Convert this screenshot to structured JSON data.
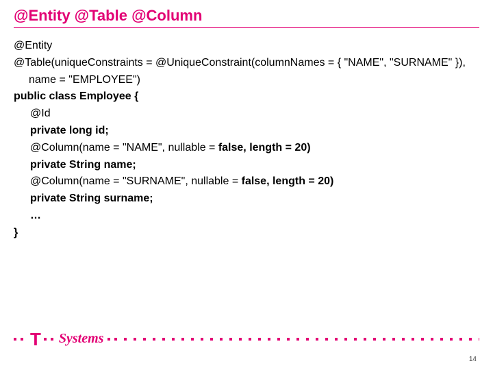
{
  "title": "@Entity @Table @Column",
  "code": {
    "l1": "@Entity",
    "l2": "@Table(uniqueConstraints = @UniqueConstraint(columnNames = { \"NAME\", \"SURNAME\" }), name = \"EMPLOYEE\")",
    "l3a": "public class Employee",
    "l3b": " {",
    "l4": "@Id",
    "l5": "private long id;",
    "l6a": "@Column(name = \"NAME\", nullable = ",
    "l6b": "false, length = 20)",
    "l7": "private String name;",
    "l8a": "@Column(name = \"SURNAME\", nullable = ",
    "l8b": "false, length = 20)",
    "l9": "private String surname;",
    "l10": "…",
    "l11": "}"
  },
  "brand": {
    "t": "T",
    "name": "Systems"
  },
  "page_number": "14",
  "colors": {
    "accent": "#e20074"
  }
}
